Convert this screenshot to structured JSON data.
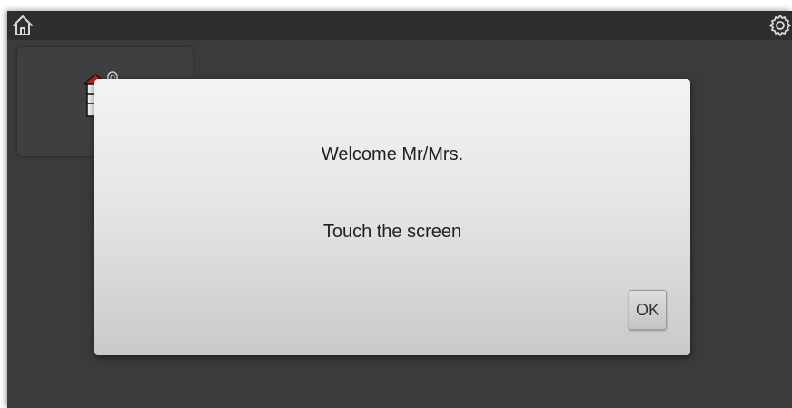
{
  "header": {
    "home_icon": "home-icon",
    "settings_icon": "gear-icon"
  },
  "tile": {
    "icon": "door-entry-icon"
  },
  "dialog": {
    "title": "Welcome Mr/Mrs.",
    "message": "Touch the screen",
    "ok_label": "OK"
  },
  "colors": {
    "background": "#3b3b3b",
    "topbar": "#2e2e2e",
    "dialog_top": "#f3f3f3",
    "dialog_bottom": "#c9c9c9",
    "accent": "#b22222"
  }
}
